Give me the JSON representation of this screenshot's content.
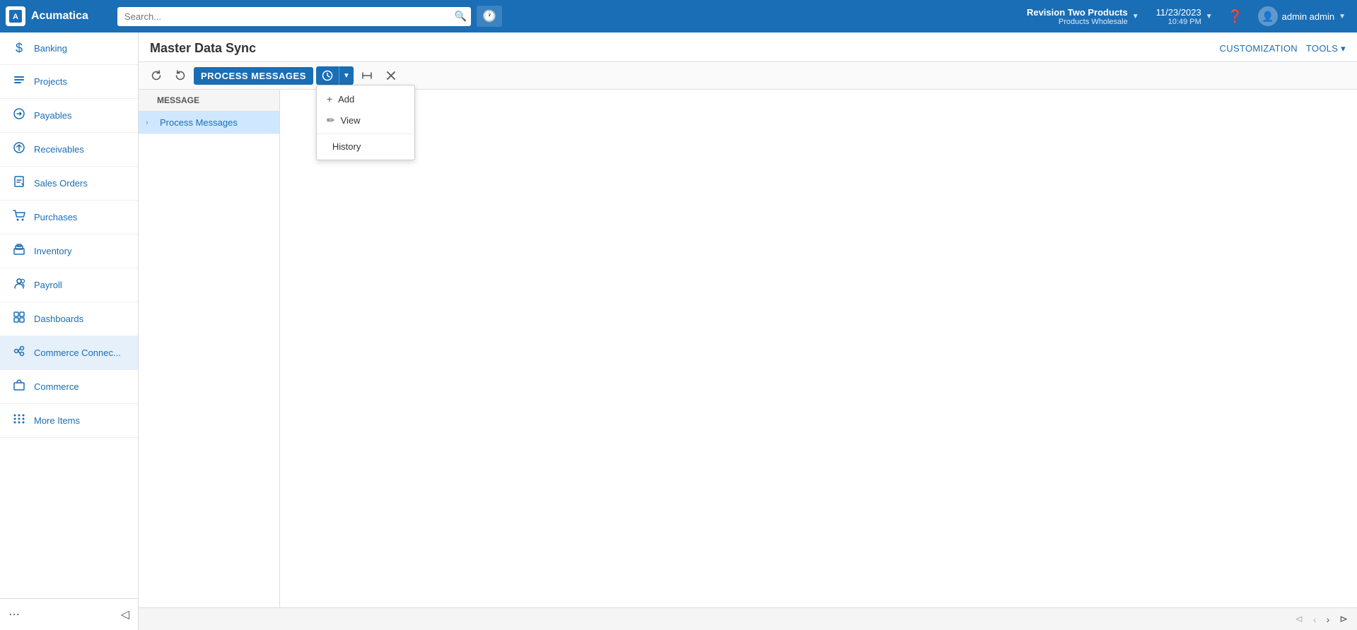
{
  "app": {
    "name": "Acumatica",
    "logo_letter": "A"
  },
  "topnav": {
    "search_placeholder": "Search...",
    "company": {
      "name": "Revision Two Products",
      "sub": "Products Wholesale"
    },
    "datetime": {
      "date": "11/23/2023",
      "time": "10:49 PM"
    },
    "user": "admin admin",
    "customization": "CUSTOMIZATION",
    "tools": "TOOLS"
  },
  "sidebar": {
    "items": [
      {
        "id": "banking",
        "label": "Banking",
        "icon": "💲"
      },
      {
        "id": "projects",
        "label": "Projects",
        "icon": "📋"
      },
      {
        "id": "payables",
        "label": "Payables",
        "icon": "↩"
      },
      {
        "id": "receivables",
        "label": "Receivables",
        "icon": "➕"
      },
      {
        "id": "sales-orders",
        "label": "Sales Orders",
        "icon": "🖊"
      },
      {
        "id": "purchases",
        "label": "Purchases",
        "icon": "🛒"
      },
      {
        "id": "inventory",
        "label": "Inventory",
        "icon": "📦"
      },
      {
        "id": "payroll",
        "label": "Payroll",
        "icon": "👥"
      },
      {
        "id": "dashboards",
        "label": "Dashboards",
        "icon": "📊"
      },
      {
        "id": "commerce-connect",
        "label": "Commerce Connec...",
        "icon": "🔗"
      },
      {
        "id": "commerce",
        "label": "Commerce",
        "icon": "🛍"
      }
    ],
    "more_items": "More Items",
    "more_icon": "⋯"
  },
  "page": {
    "title": "Master Data Sync",
    "customization_label": "CUSTOMIZATION",
    "tools_label": "TOOLS ▾"
  },
  "toolbar": {
    "refresh_label": "↺",
    "undo_label": "↶",
    "process_messages_label": "PROCESS MESSAGES",
    "clock_label": "🕐",
    "fit_label": "⊢⊣",
    "clear_label": "✕"
  },
  "dropdown_menu": {
    "items": [
      {
        "id": "add",
        "label": "Add",
        "icon": "+"
      },
      {
        "id": "view",
        "label": "View",
        "icon": "✏"
      },
      {
        "id": "history",
        "label": "History",
        "icon": ""
      }
    ]
  },
  "message_panel": {
    "column_header": "Message",
    "rows": [
      {
        "label": "Process Messages",
        "selected": true
      }
    ]
  },
  "pagination": {
    "first": "⊲",
    "prev": "‹",
    "next": "›",
    "last": "⊳"
  }
}
